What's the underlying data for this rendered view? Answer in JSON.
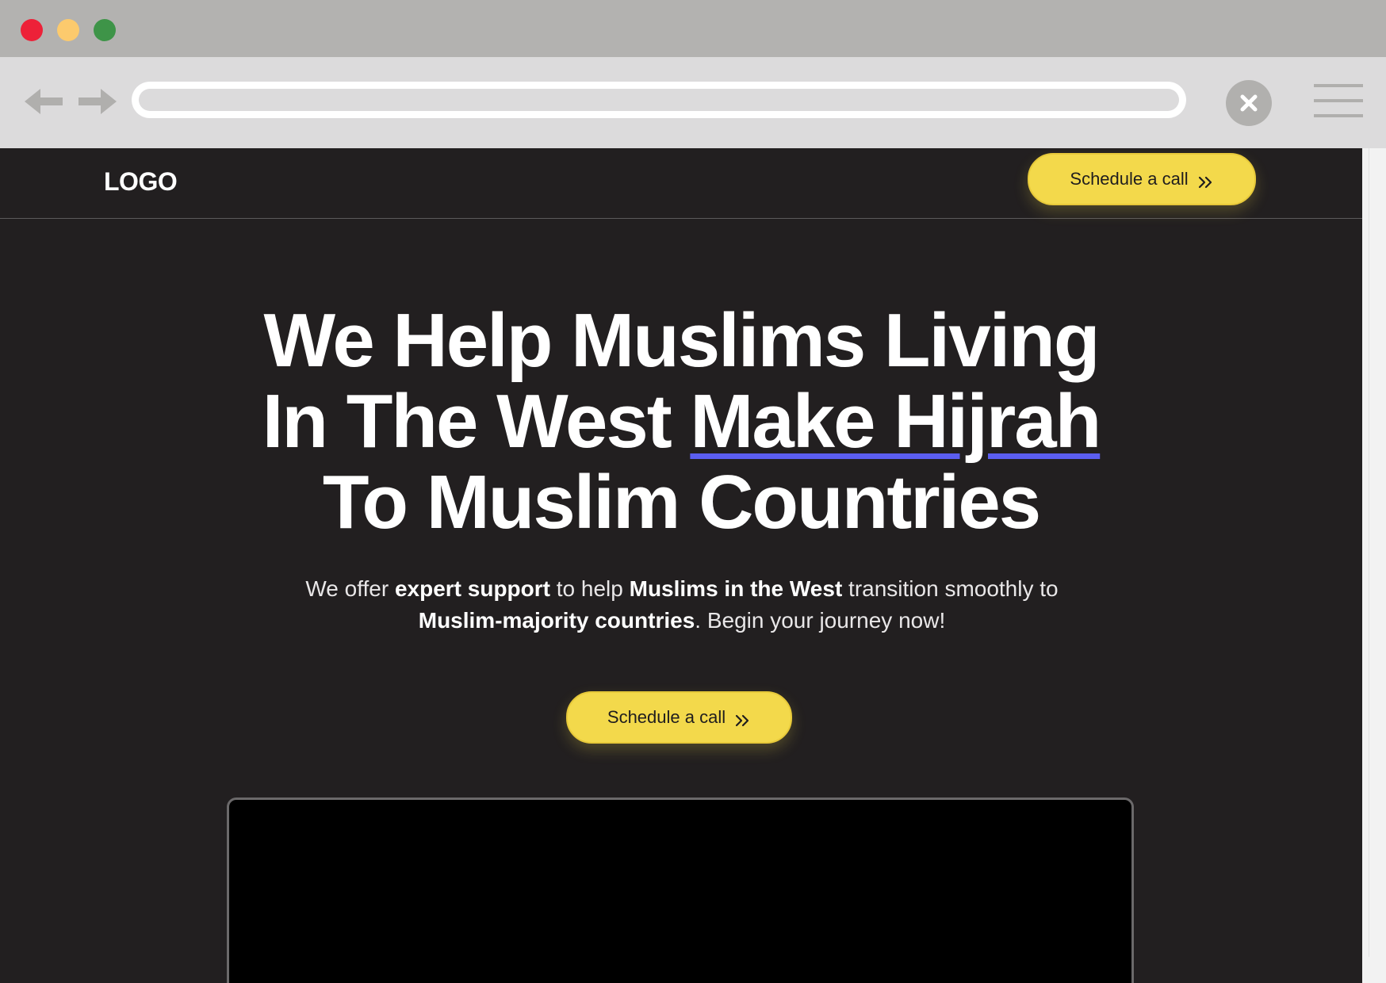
{
  "browser": {
    "traffic_lights": {
      "close": "#ed2138",
      "minimize": "#fcca6d",
      "maximize": "#3e9448"
    },
    "address_bar": {
      "value": "",
      "placeholder": ""
    },
    "icons": {
      "back": "arrow-left",
      "forward": "arrow-right",
      "close": "x",
      "menu": "hamburger"
    }
  },
  "header": {
    "logo_text": "LOGO",
    "cta_label": "Schedule a call"
  },
  "hero": {
    "title_line1": "We Help Muslims Living",
    "title_line2_plain": "In The West ",
    "title_highlight": "Make Hijrah",
    "title_line3": "To Muslim Countries",
    "subtitle": {
      "s1": "We offer ",
      "b1": "expert support",
      "s2": " to help ",
      "b2": "Muslims in the West",
      "s3": " transition smoothly to",
      "b3": "Muslim-majority countries",
      "s4": ". Begin your journey now!"
    },
    "cta_label": "Schedule a call"
  },
  "colors": {
    "page_background": "#221f20",
    "accent_yellow": "#f3d94b",
    "highlight_underline": "#5b5ef0",
    "text": "#ffffff"
  }
}
